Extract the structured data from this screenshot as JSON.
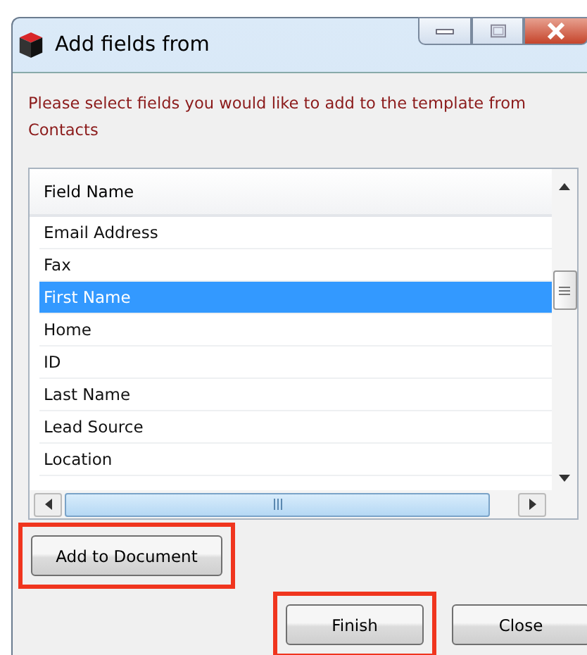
{
  "window": {
    "title": "Add fields from"
  },
  "message": "Please select fields you would like to add to the template from Contacts",
  "table": {
    "columns": [
      "Field Name"
    ],
    "rows": [
      {
        "name": "Email Address",
        "selected": false
      },
      {
        "name": "Fax",
        "selected": false
      },
      {
        "name": "First Name",
        "selected": true
      },
      {
        "name": "Home",
        "selected": false
      },
      {
        "name": "ID",
        "selected": false
      },
      {
        "name": "Last Name",
        "selected": false
      },
      {
        "name": "Lead Source",
        "selected": false
      },
      {
        "name": "Location",
        "selected": false
      }
    ]
  },
  "buttons": [
    {
      "label": "Add to Document",
      "highlighted": true,
      "kind": "add"
    },
    {
      "label": "Finish",
      "highlighted": true,
      "kind": "footer"
    },
    {
      "label": "Close",
      "highlighted": false,
      "kind": "footer"
    }
  ]
}
